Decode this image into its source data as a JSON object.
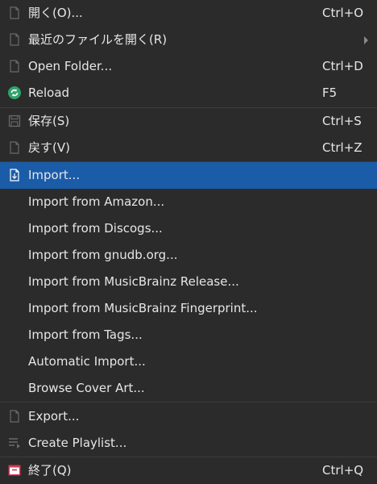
{
  "menu": {
    "items": [
      {
        "label": "開く(O)...",
        "shortcut": "Ctrl+O",
        "icon": "document-open-icon"
      },
      {
        "label": "最近のファイルを開く(R)",
        "shortcut": "",
        "icon": "recent-files-icon",
        "submenu": true
      },
      {
        "label": "Open Folder...",
        "shortcut": "Ctrl+D",
        "icon": "folder-document-icon"
      },
      {
        "label": "Reload",
        "shortcut": "F5",
        "icon": "reload-icon"
      },
      {
        "label": "保存(S)",
        "shortcut": "Ctrl+S",
        "icon": "save-icon"
      },
      {
        "label": "戻す(V)",
        "shortcut": "Ctrl+Z",
        "icon": "revert-icon"
      },
      {
        "label": "Import...",
        "shortcut": "",
        "icon": "import-icon",
        "active": true
      },
      {
        "label": "Import from Amazon...",
        "shortcut": ""
      },
      {
        "label": "Import from Discogs...",
        "shortcut": ""
      },
      {
        "label": "Import from gnudb.org...",
        "shortcut": ""
      },
      {
        "label": "Import from MusicBrainz Release...",
        "shortcut": ""
      },
      {
        "label": "Import from MusicBrainz Fingerprint...",
        "shortcut": ""
      },
      {
        "label": "Import from Tags...",
        "shortcut": ""
      },
      {
        "label": "Automatic Import...",
        "shortcut": ""
      },
      {
        "label": "Browse Cover Art...",
        "shortcut": ""
      },
      {
        "label": "Export...",
        "shortcut": "",
        "icon": "export-icon"
      },
      {
        "label": "Create Playlist...",
        "shortcut": "",
        "icon": "playlist-icon"
      },
      {
        "label": "終了(Q)",
        "shortcut": "Ctrl+Q",
        "icon": "quit-icon"
      }
    ],
    "colors": {
      "background": "#2b2b2b",
      "highlight": "#1b5ca8",
      "text": "#e6e6e6",
      "separator": "#3d3d3d",
      "reload_icon": "#2ea36b",
      "quit_icon": "#d23a55"
    }
  }
}
